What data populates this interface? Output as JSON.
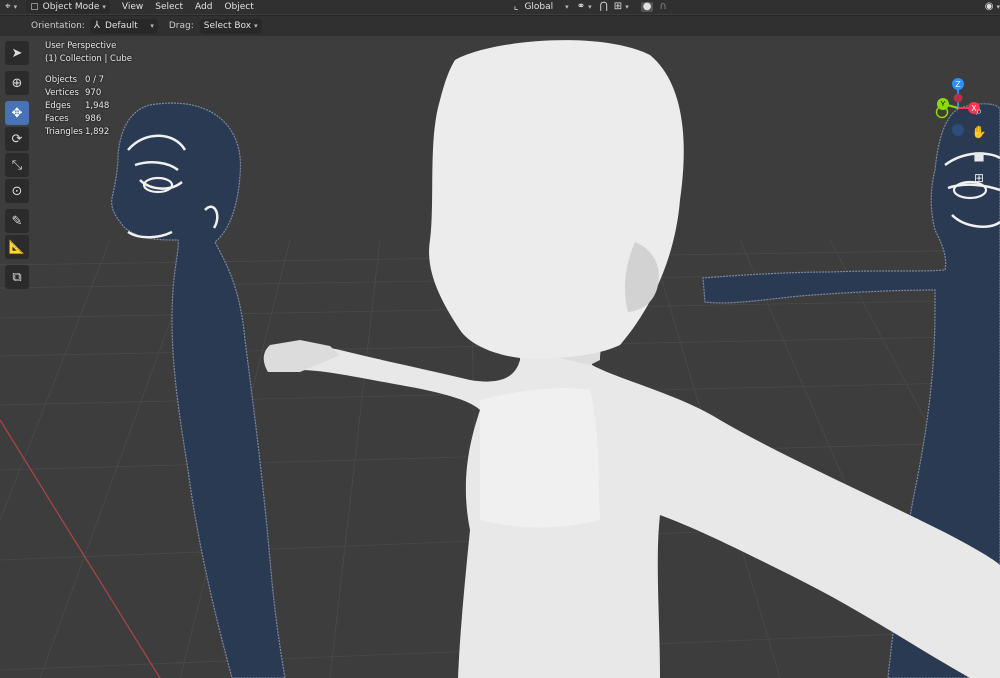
{
  "header": {
    "editor_type_icon": "3d-viewport-icon",
    "mode_label": "Object Mode",
    "menu": [
      "View",
      "Select",
      "Add",
      "Object"
    ],
    "transform_orientation": "Global",
    "icons": [
      "global-axes-icon",
      "pivot-icon",
      "snap-magnet-icon",
      "snap-increment-icon",
      "proportional-edit-icon",
      "falloff-icon",
      "visibility-eye-icon"
    ]
  },
  "tool_settings": {
    "orientation_label": "Orientation:",
    "orientation_value": "Default",
    "drag_label": "Drag:",
    "drag_value": "Select Box"
  },
  "toolbar": {
    "tools": [
      "select-box",
      "cursor",
      "move",
      "rotate",
      "scale",
      "transform",
      "annotate",
      "measure",
      "add-cube"
    ],
    "active_tool": "move"
  },
  "overlay": {
    "view_name": "User Perspective",
    "collection": "(1) Collection | Cube",
    "stats": [
      {
        "label": "Objects",
        "value": "0 / 7"
      },
      {
        "label": "Vertices",
        "value": "970"
      },
      {
        "label": "Edges",
        "value": "1,948"
      },
      {
        "label": "Faces",
        "value": "986"
      },
      {
        "label": "Triangles",
        "value": "1,892"
      }
    ]
  },
  "gizmo": {
    "z_label": "Z",
    "y_label": "Y",
    "x_label": "X",
    "colors": {
      "x": "#ff3352",
      "y": "#8bdc00",
      "z": "#2890ff"
    }
  },
  "nav_buttons": [
    "zoom-icon",
    "pan-hand-icon",
    "camera-icon",
    "perspective-grid-icon"
  ],
  "colors": {
    "viewport_bg": "#3d3d3d",
    "header_bg": "#303030",
    "active_tool": "#4772b3",
    "reference_silhouette": "#2a3a52",
    "character_mesh": "#e8e8e8",
    "x_axis_line": "#b04545"
  }
}
